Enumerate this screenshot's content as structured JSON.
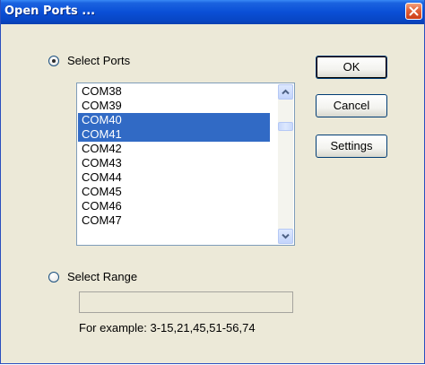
{
  "window": {
    "title": "Open Ports ..."
  },
  "select_ports": {
    "label": "Select Ports",
    "checked": true,
    "ports": [
      "COM38",
      "COM39",
      "COM40",
      "COM41",
      "COM42",
      "COM43",
      "COM44",
      "COM45",
      "COM46",
      "COM47"
    ],
    "selected": [
      "COM40",
      "COM41"
    ]
  },
  "select_range": {
    "label": "Select Range",
    "checked": false,
    "value": "",
    "example": "For example: 3-15,21,45,51-56,74"
  },
  "buttons": {
    "ok": "OK",
    "cancel": "Cancel",
    "settings": "Settings"
  },
  "colors": {
    "selection": "#316ac5",
    "dialog_bg": "#ece9d8",
    "titlebar": "#0a4fd6"
  },
  "icons": {
    "close": "close-icon",
    "scroll_up": "chevron-up-icon",
    "scroll_down": "chevron-down-icon"
  }
}
